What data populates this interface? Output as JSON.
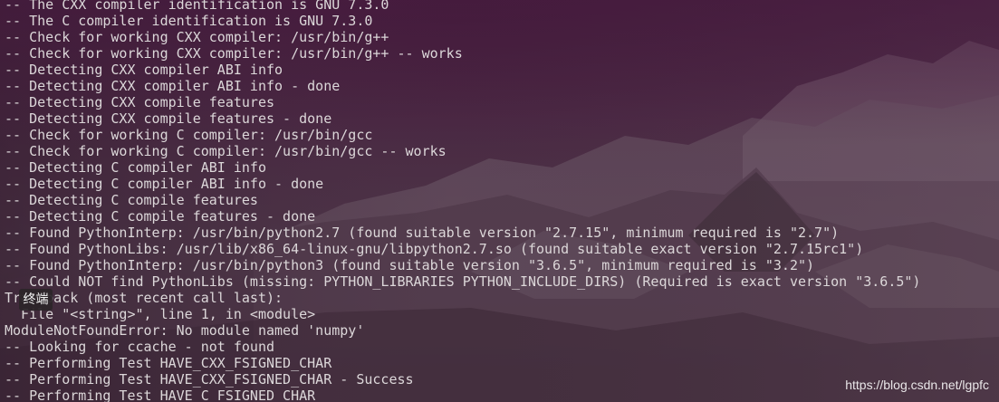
{
  "terminal": {
    "lines": [
      "-- The CXX compiler identification is GNU 7.3.0",
      "-- The C compiler identification is GNU 7.3.0",
      "-- Check for working CXX compiler: /usr/bin/g++",
      "-- Check for working CXX compiler: /usr/bin/g++ -- works",
      "-- Detecting CXX compiler ABI info",
      "-- Detecting CXX compiler ABI info - done",
      "-- Detecting CXX compile features",
      "-- Detecting CXX compile features - done",
      "-- Check for working C compiler: /usr/bin/gcc",
      "-- Check for working C compiler: /usr/bin/gcc -- works",
      "-- Detecting C compiler ABI info",
      "-- Detecting C compiler ABI info - done",
      "-- Detecting C compile features",
      "-- Detecting C compile features - done",
      "-- Found PythonInterp: /usr/bin/python2.7 (found suitable version \"2.7.15\", minimum required is \"2.7\")",
      "-- Found PythonLibs: /usr/lib/x86_64-linux-gnu/libpython2.7.so (found suitable exact version \"2.7.15rc1\")",
      "-- Found PythonInterp: /usr/bin/python3 (found suitable version \"3.6.5\", minimum required is \"3.2\")",
      "-- Could NOT find PythonLibs (missing: PYTHON_LIBRARIES PYTHON_INCLUDE_DIRS) (Required is exact version \"3.6.5\")",
      "Traceback (most recent call last):",
      "  File \"<string>\", line 1, in <module>",
      "ModuleNotFoundError: No module named 'numpy'",
      "-- Looking for ccache - not found",
      "-- Performing Test HAVE_CXX_FSIGNED_CHAR",
      "-- Performing Test HAVE_CXX_FSIGNED_CHAR - Success",
      "-- Performing Test HAVE_C_FSIGNED_CHAR"
    ]
  },
  "tooltip": {
    "text": "终端"
  },
  "watermark": {
    "text": "https://blog.csdn.net/lgpfc"
  },
  "colors": {
    "terminal_text": "#dcd7d9",
    "wallpaper_top": "#3f1c37",
    "wallpaper_mountains": "#6e5a68",
    "tooltip_background": "#2c2529",
    "watermark_text": "#ffffff"
  }
}
